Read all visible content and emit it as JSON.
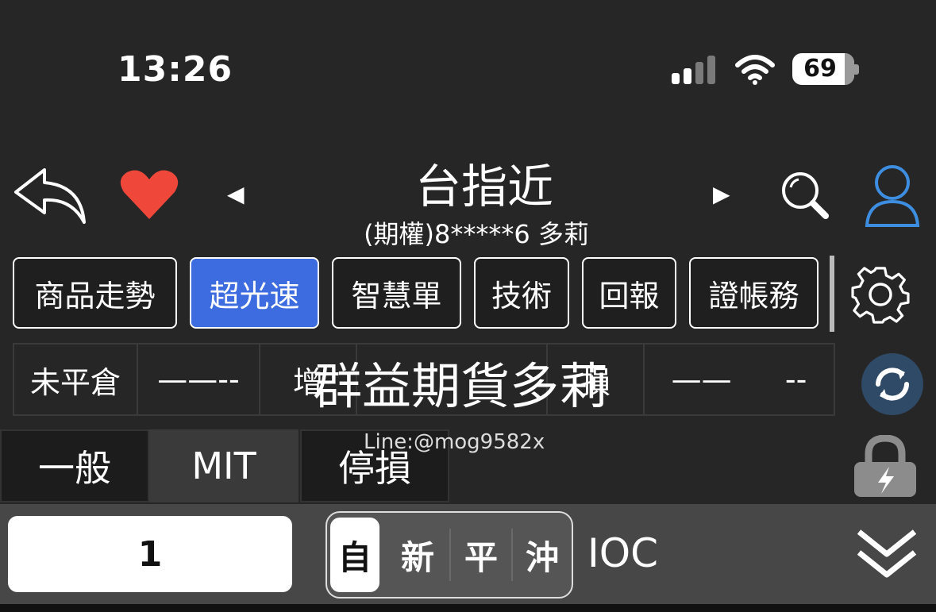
{
  "status_bar": {
    "time": "13:26",
    "battery_level": "69",
    "battery_fraction": 0.69
  },
  "header": {
    "title": "台指近",
    "subtitle": "(期權)8*****6  多莉",
    "prev_arrow": "◀",
    "next_arrow": "▶"
  },
  "tabs": [
    {
      "label": "商品走勢",
      "active": false
    },
    {
      "label": "超光速",
      "active": true
    },
    {
      "label": "智慧單",
      "active": false
    },
    {
      "label": "技術",
      "active": false
    },
    {
      "label": "回報",
      "active": false
    },
    {
      "label": "證帳務",
      "active": false
    }
  ],
  "position": {
    "label": "未平倉",
    "value1": "——--",
    "col3": "增",
    "col5": "損",
    "value2": "——",
    "value3": "--"
  },
  "watermark": {
    "text": "群益期貨多莉",
    "line": "Line:@mog9582x"
  },
  "order_types": [
    {
      "label": "一般",
      "active": false
    },
    {
      "label": "MIT",
      "active": true
    },
    {
      "label": "停損",
      "active": false
    }
  ],
  "order": {
    "quantity": "1",
    "open_close": [
      {
        "label": "自",
        "active": true
      },
      {
        "label": "新",
        "active": false
      },
      {
        "label": "平",
        "active": false
      },
      {
        "label": "沖",
        "active": false
      }
    ],
    "condition": "IOC"
  },
  "colors": {
    "accent": "#3d6be0",
    "heart": "#f0473b",
    "user_icon": "#3d8ee0"
  }
}
